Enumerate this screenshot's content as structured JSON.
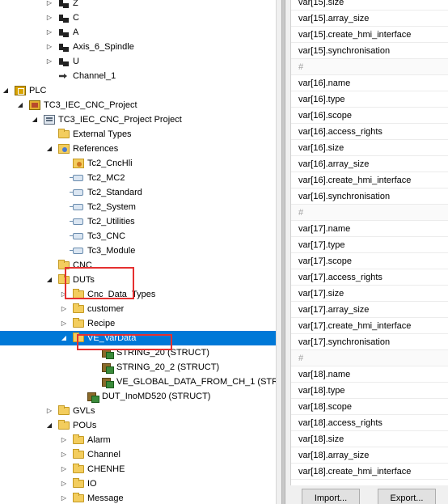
{
  "tree": {
    "items": [
      {
        "label": "Z",
        "name": "tree-item-axis-z",
        "icon": "axis-icon",
        "indent": 60,
        "expander": "collapsed"
      },
      {
        "label": "C",
        "name": "tree-item-axis-c",
        "icon": "axis-icon",
        "indent": 60,
        "expander": "collapsed"
      },
      {
        "label": "A",
        "name": "tree-item-axis-a",
        "icon": "axis-icon",
        "indent": 60,
        "expander": "collapsed"
      },
      {
        "label": "Axis_6_Spindle",
        "name": "tree-item-axis-6-spindle",
        "icon": "axis-icon",
        "indent": 60,
        "expander": "collapsed"
      },
      {
        "label": "U",
        "name": "tree-item-axis-u",
        "icon": "axis-icon",
        "indent": 60,
        "expander": "collapsed"
      },
      {
        "label": "Channel_1",
        "name": "tree-item-channel-1",
        "icon": "channel-icon",
        "indent": 60,
        "expander": "none"
      },
      {
        "label": "PLC",
        "name": "tree-item-plc",
        "icon": "plc-icon",
        "indent": 6,
        "expander": "expanded"
      },
      {
        "label": "TC3_IEC_CNC_Project",
        "name": "tree-item-tc3-project",
        "icon": "plc-project-icon",
        "indent": 24,
        "expander": "expanded"
      },
      {
        "label": "TC3_IEC_CNC_Project Project",
        "name": "tree-item-tc3-project-project",
        "icon": "plc-project-file-icon",
        "indent": 42,
        "expander": "expanded"
      },
      {
        "label": "External Types",
        "name": "tree-item-external-types",
        "icon": "folder-icon",
        "indent": 60,
        "expander": "none"
      },
      {
        "label": "References",
        "name": "tree-item-references",
        "icon": "references-icon",
        "indent": 60,
        "expander": "expanded"
      },
      {
        "label": "Tc2_CncHli",
        "name": "tree-item-ref-tc2-cnchli",
        "icon": "library-warning-icon",
        "indent": 78,
        "expander": "none"
      },
      {
        "label": "Tc2_MC2",
        "name": "tree-item-ref-tc2-mc2",
        "icon": "library-icon",
        "indent": 78,
        "expander": "none"
      },
      {
        "label": "Tc2_Standard",
        "name": "tree-item-ref-tc2-standard",
        "icon": "library-icon",
        "indent": 78,
        "expander": "none"
      },
      {
        "label": "Tc2_System",
        "name": "tree-item-ref-tc2-system",
        "icon": "library-icon",
        "indent": 78,
        "expander": "none"
      },
      {
        "label": "Tc2_Utilities",
        "name": "tree-item-ref-tc2-utilities",
        "icon": "library-icon",
        "indent": 78,
        "expander": "none"
      },
      {
        "label": "Tc3_CNC",
        "name": "tree-item-ref-tc3-cnc",
        "icon": "library-icon",
        "indent": 78,
        "expander": "none"
      },
      {
        "label": "Tc3_Module",
        "name": "tree-item-ref-tc3-module",
        "icon": "library-icon",
        "indent": 78,
        "expander": "none"
      },
      {
        "label": "CNC",
        "name": "tree-item-cnc",
        "icon": "folder-icon",
        "indent": 60,
        "expander": "none"
      },
      {
        "label": "DUTs",
        "name": "tree-item-duts",
        "icon": "folder-open-icon",
        "indent": 60,
        "expander": "expanded"
      },
      {
        "label": "Cnc_Data_Types",
        "name": "tree-item-cnc-data-types",
        "icon": "folder-icon",
        "indent": 78,
        "expander": "collapsed"
      },
      {
        "label": "customer",
        "name": "tree-item-customer",
        "icon": "folder-icon",
        "indent": 78,
        "expander": "collapsed"
      },
      {
        "label": "Recipe",
        "name": "tree-item-recipe",
        "icon": "folder-icon",
        "indent": 78,
        "expander": "collapsed"
      },
      {
        "label": "VE_VarData",
        "name": "tree-item-ve-vardata",
        "icon": "folder-open-icon",
        "indent": 78,
        "expander": "expanded",
        "selected": true
      },
      {
        "label": "STRING_20 (STRUCT)",
        "name": "tree-item-string-20",
        "icon": "struct-icon",
        "indent": 114,
        "expander": "none"
      },
      {
        "label": "STRING_20_2 (STRUCT)",
        "name": "tree-item-string-20-2",
        "icon": "struct-icon",
        "indent": 114,
        "expander": "none"
      },
      {
        "label": "VE_GLOBAL_DATA_FROM_CH_1 (STRU",
        "name": "tree-item-ve-global-data",
        "icon": "struct-icon",
        "indent": 114,
        "expander": "none"
      },
      {
        "label": "DUT_InoMD520 (STRUCT)",
        "name": "tree-item-dut-inomd520",
        "icon": "struct-icon",
        "indent": 96,
        "expander": "none"
      },
      {
        "label": "GVLs",
        "name": "tree-item-gvls",
        "icon": "folder-icon",
        "indent": 60,
        "expander": "collapsed"
      },
      {
        "label": "POUs",
        "name": "tree-item-pous",
        "icon": "folder-open-icon",
        "indent": 60,
        "expander": "expanded"
      },
      {
        "label": "Alarm",
        "name": "tree-item-alarm",
        "icon": "folder-icon",
        "indent": 78,
        "expander": "collapsed"
      },
      {
        "label": "Channel",
        "name": "tree-item-channel",
        "icon": "folder-icon",
        "indent": 78,
        "expander": "collapsed"
      },
      {
        "label": "CHENHE",
        "name": "tree-item-chenhe",
        "icon": "folder-icon",
        "indent": 78,
        "expander": "collapsed"
      },
      {
        "label": "IO",
        "name": "tree-item-io",
        "icon": "folder-icon",
        "indent": 78,
        "expander": "collapsed"
      },
      {
        "label": "Message",
        "name": "tree-item-message",
        "icon": "folder-icon",
        "indent": 78,
        "expander": "collapsed"
      }
    ]
  },
  "variables": {
    "rows": [
      "var[15].size",
      "var[15].array_size",
      "var[15].create_hmi_interface",
      "var[15].synchronisation",
      "#",
      "var[16].name",
      "var[16].type",
      "var[16].scope",
      "var[16].access_rights",
      "var[16].size",
      "var[16].array_size",
      "var[16].create_hmi_interface",
      "var[16].synchronisation",
      "#",
      "var[17].name",
      "var[17].type",
      "var[17].scope",
      "var[17].access_rights",
      "var[17].size",
      "var[17].array_size",
      "var[17].create_hmi_interface",
      "var[17].synchronisation",
      "#",
      "var[18].name",
      "var[18].type",
      "var[18].scope",
      "var[18].access_rights",
      "var[18].size",
      "var[18].array_size",
      "var[18].create_hmi_interface"
    ]
  },
  "buttons": {
    "import_label": "Import...",
    "export_label": "Export..."
  },
  "colors": {
    "selection": "#0078d7",
    "highlight_box": "#e53030"
  }
}
